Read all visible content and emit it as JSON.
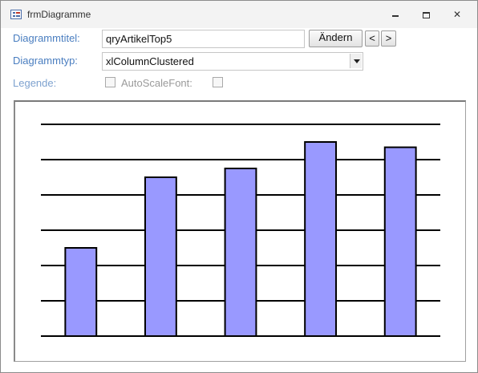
{
  "window": {
    "title": "frmDiagramme"
  },
  "form": {
    "title_label": "Diagrammtitel:",
    "title_value": "qryArtikelTop5",
    "change_button": "Ändern",
    "prev_button": "<",
    "next_button": ">",
    "type_label": "Diagrammtyp:",
    "type_value": "xlColumnClustered",
    "legend_label": "Legende:",
    "legend_checked": false,
    "autoscale_label": "AutoScaleFont:",
    "autoscale_checked": false
  },
  "chart_data": {
    "type": "bar",
    "categories": [
      "",
      "",
      "",
      "",
      ""
    ],
    "values": [
      2.5,
      4.5,
      4.75,
      5.5,
      5.35
    ],
    "ylim": [
      0,
      6
    ],
    "gridlines": 6,
    "grid": true,
    "bar_color": "#9999ff",
    "bar_stroke": "#000000",
    "title": "",
    "xlabel": "",
    "ylabel": ""
  }
}
